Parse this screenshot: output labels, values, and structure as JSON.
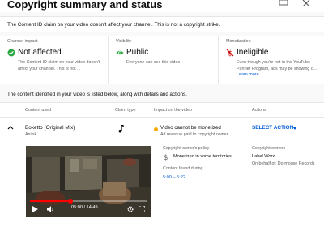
{
  "header": {
    "title": "Copyright summary and status",
    "icons": [
      "feedback-icon",
      "close-icon"
    ]
  },
  "banner": {
    "text": "The Content ID claim on your video doesn't affect your channel. This is not a copyright strike."
  },
  "cards": {
    "channel_impact": {
      "label": "Channel impact",
      "icon": "check-circle-icon",
      "value": "Not affected",
      "description": "The Content ID claim on your video doesn't affect your channel. This is not ..."
    },
    "visibility": {
      "label": "Visibility",
      "icon": "eye-icon",
      "value": "Public",
      "description": "Everyone can see this video"
    },
    "monetization": {
      "label": "Monetization",
      "icon": "demonetized-icon",
      "value": "Ineligible",
      "description": "Even though you're not in the YouTube Partner Program, ads may be showing o...",
      "link": "Learn more"
    }
  },
  "listed_text": "The content identified in your video is listed below, along with details and actions.",
  "table": {
    "headers": [
      "Content used",
      "Claim type",
      "Impact on the video",
      "Actions"
    ],
    "row": {
      "content_title": "Boketto (Original Mix)",
      "content_artist": "Anilsk",
      "claim_type_icon": "music-note-icon",
      "impact_title": "Video cannot be monetized",
      "impact_subtitle": "Ad revenue paid to copyright owner",
      "action_label": "SELECT ACTION",
      "video": {
        "time": "05:00 / 14:49",
        "progress": 0.345,
        "controls": [
          "play-icon",
          "volume-icon",
          "settings-icon",
          "fullscreen-icon"
        ]
      },
      "policy_label": "Copyright owner's policy",
      "policy_value": "Monetized in some territories",
      "found_label": "Content found during",
      "found_value": "5:00 – 5:22",
      "owners_label": "Copyright owners",
      "owner_name": "Label Worx",
      "owner_behalf": "On behalf of: Dormouse Records"
    }
  },
  "colors": {
    "accent": "#065fd4",
    "success": "#2ba640",
    "warning": "#f2a900",
    "error": "#cc0000",
    "progress": "#ff0000"
  }
}
